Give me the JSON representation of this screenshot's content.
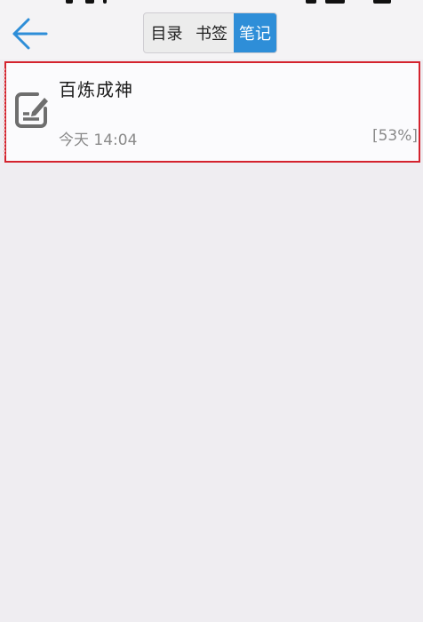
{
  "header": {
    "back_icon": "arrow-left-icon",
    "tabs": [
      {
        "label": "目录",
        "active": false
      },
      {
        "label": "书签",
        "active": false
      },
      {
        "label": "笔记",
        "active": true
      }
    ],
    "accent_color": "#2e8ed8"
  },
  "notes": [
    {
      "icon": "note-edit-icon",
      "title": "百炼成神",
      "time": "今天 14:04",
      "progress": "[53%]"
    }
  ],
  "colors": {
    "background": "#efedf1",
    "highlight_border": "#d4232e"
  }
}
